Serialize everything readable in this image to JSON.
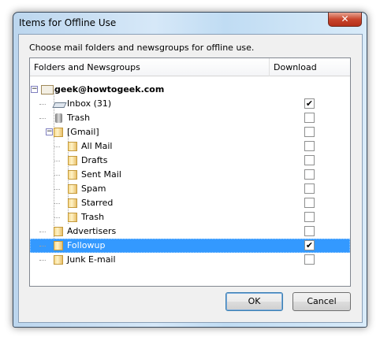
{
  "window": {
    "title": "Items for Offline Use",
    "close_label": "✕"
  },
  "instruction": "Choose mail folders and newsgroups for offline use.",
  "columns": {
    "folders": "Folders and Newsgroups",
    "download": "Download"
  },
  "rows": [
    {
      "label": "geek@howtogeek.com",
      "level": 0,
      "icon": "account-icon",
      "checked": null,
      "bold": true
    },
    {
      "label": "Inbox (31)",
      "level": 1,
      "icon": "inbox-icon",
      "checked": true
    },
    {
      "label": "Trash",
      "level": 1,
      "icon": "trash-icon",
      "checked": false
    },
    {
      "label": "[Gmail]",
      "level": 1,
      "icon": "folder-icon",
      "checked": false,
      "expanded": true
    },
    {
      "label": "All Mail",
      "level": 2,
      "icon": "folder-icon",
      "checked": false
    },
    {
      "label": "Drafts",
      "level": 2,
      "icon": "folder-icon",
      "checked": false
    },
    {
      "label": "Sent Mail",
      "level": 2,
      "icon": "folder-icon",
      "checked": false
    },
    {
      "label": "Spam",
      "level": 2,
      "icon": "folder-icon",
      "checked": false
    },
    {
      "label": "Starred",
      "level": 2,
      "icon": "folder-icon",
      "checked": false
    },
    {
      "label": "Trash",
      "level": 2,
      "icon": "folder-icon",
      "checked": false
    },
    {
      "label": "Advertisers",
      "level": 1,
      "icon": "folder-icon",
      "checked": false
    },
    {
      "label": "Followup",
      "level": 1,
      "icon": "folder-icon",
      "checked": true,
      "selected": true
    },
    {
      "label": "Junk E-mail",
      "level": 1,
      "icon": "folder-icon",
      "checked": false
    }
  ],
  "buttons": {
    "ok": "OK",
    "cancel": "Cancel"
  },
  "colors": {
    "selection": "#3399ff"
  }
}
